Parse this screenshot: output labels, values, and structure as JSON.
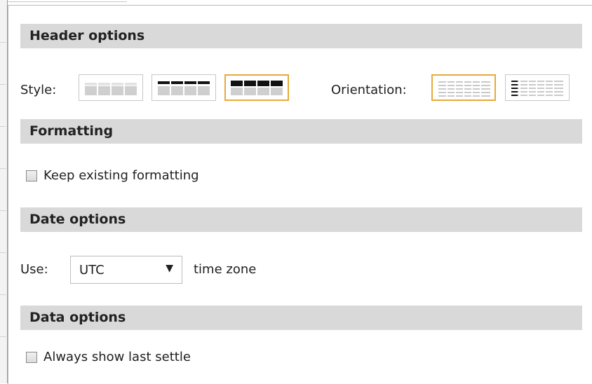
{
  "header_options": {
    "title": "Header options",
    "style_label": "Style:",
    "orientation_label": "Orientation:",
    "style_swatches": [
      "style-light",
      "style-medium",
      "style-dark"
    ],
    "style_selected_index": 2,
    "orientation_swatches": [
      "orientation-horizontal",
      "orientation-vertical"
    ],
    "orientation_selected_index": 0
  },
  "formatting": {
    "title": "Formatting",
    "keep_existing_label": "Keep existing formatting",
    "keep_existing_checked": false
  },
  "date_options": {
    "title": "Date options",
    "use_label": "Use:",
    "timezone_value": "UTC",
    "timezone_suffix": "time zone"
  },
  "data_options": {
    "title": "Data options",
    "always_show_label": "Always show last settle",
    "always_show_checked": false
  },
  "colors": {
    "section_header_bg": "#d9d9d9",
    "selected_border": "#e8a93a"
  }
}
